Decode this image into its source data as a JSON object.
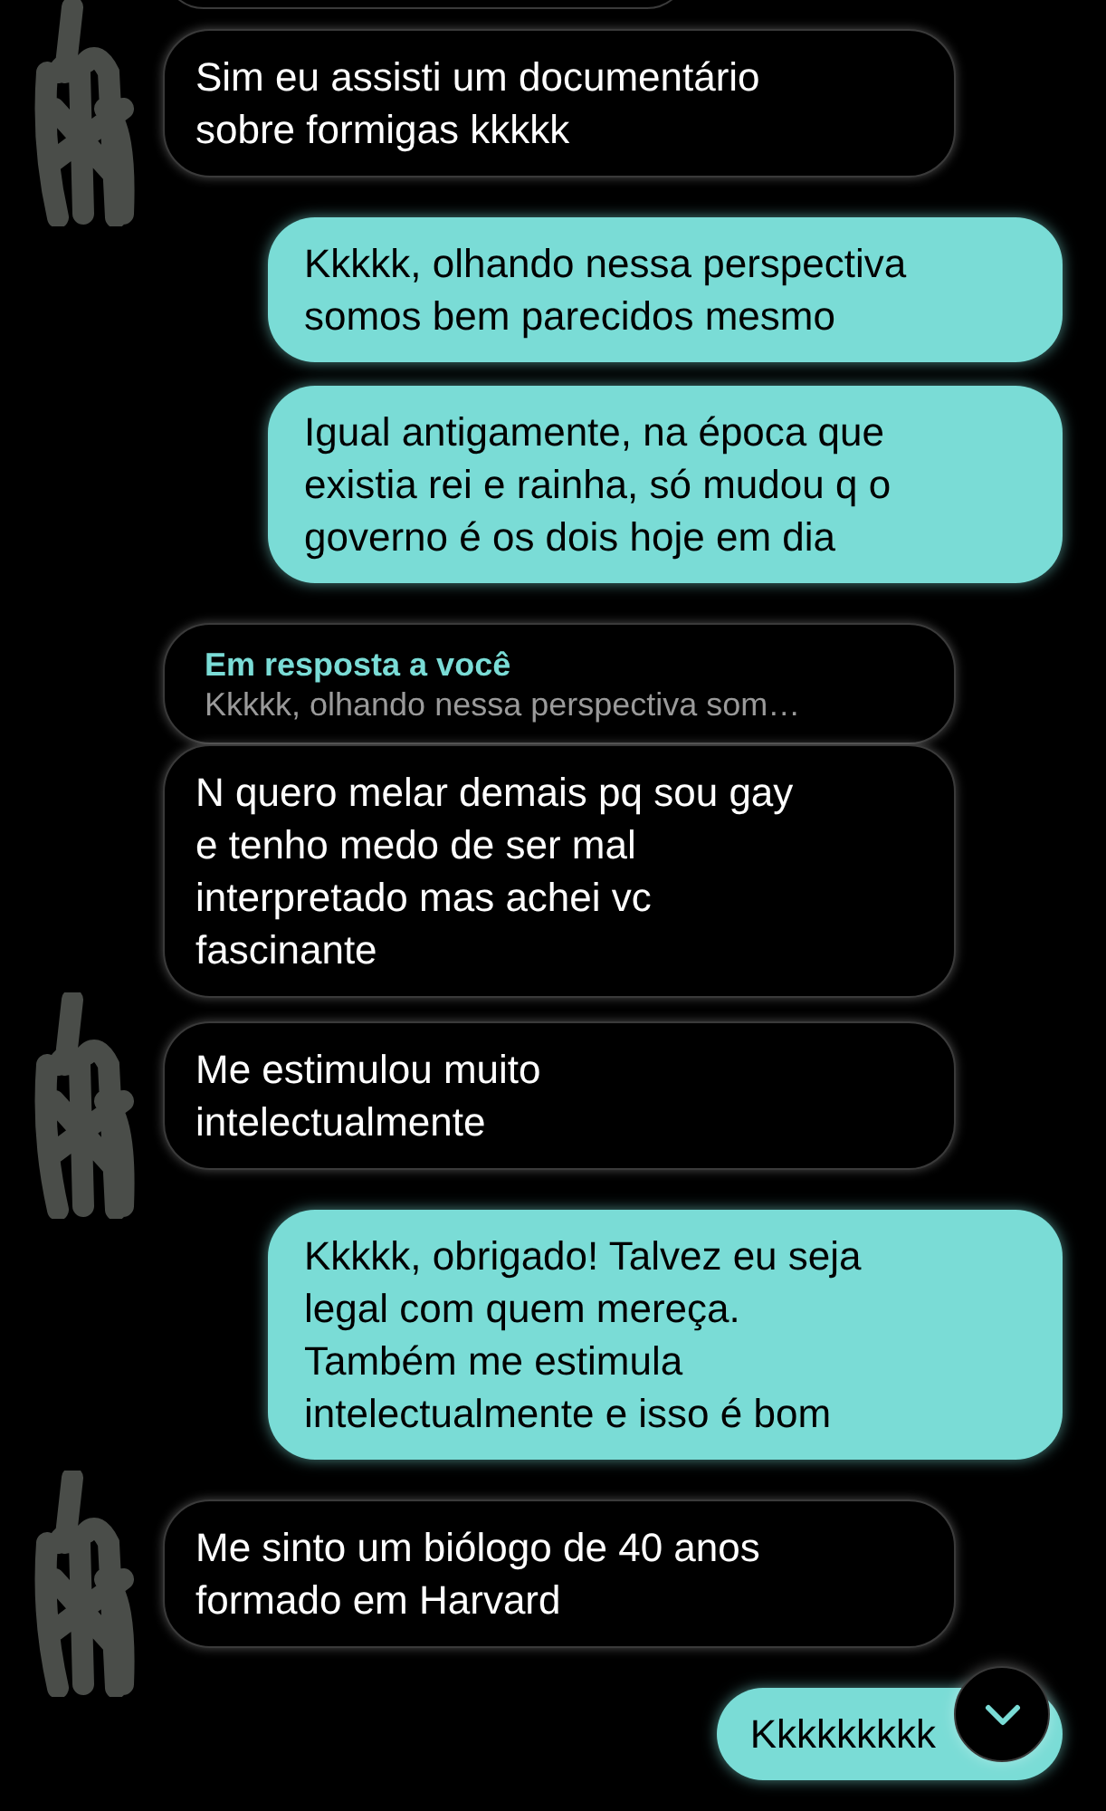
{
  "messages": [
    {
      "kind": "received",
      "text": "Sim eu assisti um documentário\nsobre formigas kkkkk",
      "avatar_scribbled": true
    },
    {
      "kind": "sent",
      "text": "Kkkkk, olhando nessa perspectiva\nsomos bem parecidos mesmo"
    },
    {
      "kind": "sent",
      "text": "Igual antigamente, na época que\nexistia rei e rainha, só mudou q o\ngoverno é os dois hoje em dia"
    },
    {
      "kind": "received",
      "reply": {
        "label": "Em resposta a você",
        "quote": "Kkkkk, olhando nessa perspectiva som…"
      },
      "text": "N quero melar demais pq sou gay\ne tenho medo de ser mal\ninterpretado mas achei vc\nfascinante",
      "avatar_scribbled": false
    },
    {
      "kind": "received",
      "text": "Me estimulou muito\nintelectualmente",
      "avatar_scribbled": true
    },
    {
      "kind": "sent",
      "text": "Kkkkk, obrigado! Talvez eu seja\nlegal com quem mereça.\n Também me estimula\nintelectualmente e isso é bom"
    },
    {
      "kind": "received",
      "text": "Me sinto um biólogo de 40 anos\nformado em Harvard",
      "avatar_scribbled": true
    },
    {
      "kind": "sent",
      "text": "Kkkkkkkkk"
    }
  ]
}
